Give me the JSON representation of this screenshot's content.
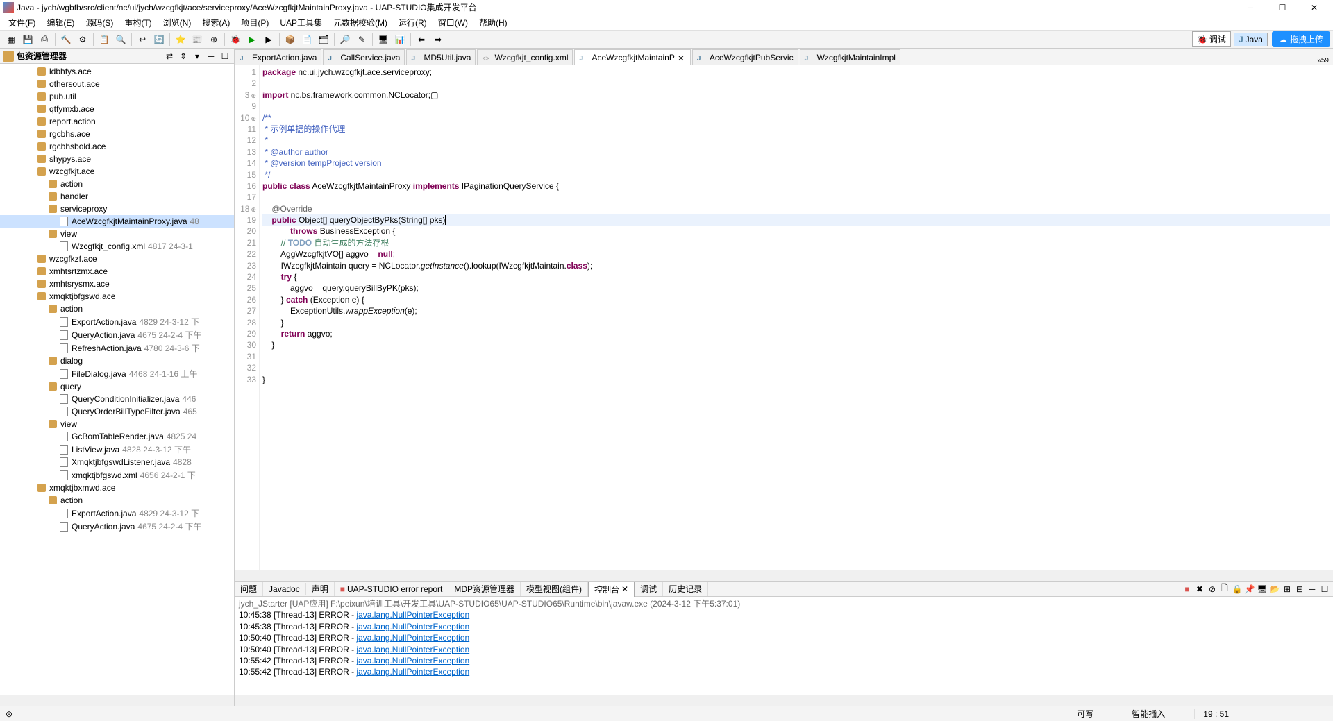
{
  "window": {
    "title": "Java - jych/wgbfb/src/client/nc/ui/jych/wzcgfkjt/ace/serviceproxy/AceWzcgfkjtMaintainProxy.java - UAP-STUDIO集成开发平台"
  },
  "menu": {
    "file": "文件(F)",
    "edit": "编辑(E)",
    "source": "源码(S)",
    "refactor": "重构(T)",
    "navigate": "浏览(N)",
    "search": "搜索(A)",
    "project": "项目(P)",
    "uap": "UAP工具集",
    "metadata": "元数据校验(M)",
    "run": "运行(R)",
    "window": "窗口(W)",
    "help": "帮助(H)"
  },
  "perspective": {
    "debug": "调试",
    "java": "Java",
    "upload": "拖拽上传"
  },
  "leftPanel": {
    "title": "包资源管理器",
    "items": [
      {
        "depth": 3,
        "icon": "pkg",
        "label": "ldbhfys.ace"
      },
      {
        "depth": 3,
        "icon": "pkg",
        "label": "othersout.ace"
      },
      {
        "depth": 3,
        "icon": "pkg",
        "label": "pub.util"
      },
      {
        "depth": 3,
        "icon": "pkg",
        "label": "qtfymxb.ace"
      },
      {
        "depth": 3,
        "icon": "pkg",
        "label": "report.action"
      },
      {
        "depth": 3,
        "icon": "pkg",
        "label": "rgcbhs.ace"
      },
      {
        "depth": 3,
        "icon": "pkg",
        "label": "rgcbhsbold.ace"
      },
      {
        "depth": 3,
        "icon": "pkg",
        "label": "shypys.ace"
      },
      {
        "depth": 3,
        "icon": "pkg",
        "label": "wzcgfkjt.ace"
      },
      {
        "depth": 4,
        "icon": "pkg",
        "label": "action"
      },
      {
        "depth": 4,
        "icon": "pkg",
        "label": "handler"
      },
      {
        "depth": 4,
        "icon": "pkg",
        "label": "serviceproxy"
      },
      {
        "depth": 5,
        "icon": "file",
        "label": "AceWzcgfkjtMaintainProxy.java",
        "meta": "48",
        "selected": true
      },
      {
        "depth": 4,
        "icon": "pkg",
        "label": "view"
      },
      {
        "depth": 5,
        "icon": "file",
        "label": "Wzcgfkjt_config.xml",
        "meta": "4817  24-3-1"
      },
      {
        "depth": 3,
        "icon": "pkg",
        "label": "wzcgfkzf.ace"
      },
      {
        "depth": 3,
        "icon": "pkg",
        "label": "xmhtsrtzmx.ace"
      },
      {
        "depth": 3,
        "icon": "pkg",
        "label": "xmhtsrysmx.ace"
      },
      {
        "depth": 3,
        "icon": "pkg",
        "label": "xmqktjbfgswd.ace"
      },
      {
        "depth": 4,
        "icon": "pkg",
        "label": "action"
      },
      {
        "depth": 5,
        "icon": "file",
        "label": "ExportAction.java",
        "meta": "4829  24-3-12 下"
      },
      {
        "depth": 5,
        "icon": "file",
        "label": "QueryAction.java",
        "meta": "4675  24-2-4 下午"
      },
      {
        "depth": 5,
        "icon": "file",
        "label": "RefreshAction.java",
        "meta": "4780  24-3-6 下"
      },
      {
        "depth": 4,
        "icon": "pkg",
        "label": "dialog"
      },
      {
        "depth": 5,
        "icon": "file",
        "label": "FileDialog.java",
        "meta": "4468  24-1-16 上午"
      },
      {
        "depth": 4,
        "icon": "pkg",
        "label": "query"
      },
      {
        "depth": 5,
        "icon": "file",
        "label": "QueryConditionInitializer.java",
        "meta": "446"
      },
      {
        "depth": 5,
        "icon": "file",
        "label": "QueryOrderBillTypeFilter.java",
        "meta": "465"
      },
      {
        "depth": 4,
        "icon": "pkg",
        "label": "view"
      },
      {
        "depth": 5,
        "icon": "file",
        "label": "GcBomTableRender.java",
        "meta": "4825  24"
      },
      {
        "depth": 5,
        "icon": "file",
        "label": "ListView.java",
        "meta": "4828  24-3-12 下午"
      },
      {
        "depth": 5,
        "icon": "file",
        "label": "XmqktjbfgswdListener.java",
        "meta": "4828"
      },
      {
        "depth": 5,
        "icon": "file",
        "label": "xmqktjbfgswd.xml",
        "meta": "4656  24-2-1 下"
      },
      {
        "depth": 3,
        "icon": "pkg",
        "label": "xmqktjbxmwd.ace"
      },
      {
        "depth": 4,
        "icon": "pkg",
        "label": "action"
      },
      {
        "depth": 5,
        "icon": "file",
        "label": "ExportAction.java",
        "meta": "4829  24-3-12 下"
      },
      {
        "depth": 5,
        "icon": "file",
        "label": "QueryAction.java",
        "meta": "4675  24-2-4 下午"
      }
    ]
  },
  "tabs": [
    {
      "icon": "java",
      "label": "ExportAction.java"
    },
    {
      "icon": "java",
      "label": "CallService.java"
    },
    {
      "icon": "java",
      "label": "MD5Util.java"
    },
    {
      "icon": "xml",
      "label": "Wzcgfkjt_config.xml"
    },
    {
      "icon": "java",
      "label": "AceWzcgfkjtMaintainP",
      "active": true,
      "close": true
    },
    {
      "icon": "java",
      "label": "AceWzcgfkjtPubServic"
    },
    {
      "icon": "java",
      "label": "WzcgfkjtMaintainImpl"
    }
  ],
  "tabMore": "»59",
  "code": {
    "lines": [
      {
        "n": 1,
        "html": "<span class='kw'>package</span> nc.ui.jych.wzcgfkjt.ace.serviceproxy;"
      },
      {
        "n": 2,
        "html": ""
      },
      {
        "n": 3,
        "fold": true,
        "html": "<span class='kw'>import</span> nc.bs.framework.common.NCLocator;▢"
      },
      {
        "n": 9,
        "html": ""
      },
      {
        "n": 10,
        "fold": true,
        "html": "<span class='doc'>/**</span>"
      },
      {
        "n": 11,
        "html": "<span class='doc'> * 示例单据的操作代理</span>"
      },
      {
        "n": 12,
        "html": "<span class='doc'> * </span>"
      },
      {
        "n": 13,
        "html": "<span class='doc'> * @author author</span>"
      },
      {
        "n": 14,
        "html": "<span class='doc'> * @version tempProject version</span>"
      },
      {
        "n": 15,
        "html": "<span class='doc'> */</span>"
      },
      {
        "n": 16,
        "html": "<span class='kw'>public</span> <span class='kw'>class</span> AceWzcgfkjtMaintainProxy <span class='kw'>implements</span> IPaginationQueryService {"
      },
      {
        "n": 17,
        "html": ""
      },
      {
        "n": 18,
        "fold": true,
        "html": "    <span class='ann'>@Override</span>"
      },
      {
        "n": 19,
        "hl": true,
        "html": "    <span class='kw'>public</span> Object[] queryObjectByPks(String[] pks)<span class='cursor'></span>"
      },
      {
        "n": 20,
        "html": "            <span class='kw'>throws</span> BusinessException {"
      },
      {
        "n": 21,
        "html": "        <span class='cm'>// </span><span class='todo'>TODO</span><span class='cm'> 自动生成的方法存根</span>"
      },
      {
        "n": 22,
        "html": "        AggWzcgfkjtVO[] aggvo = <span class='kw'>null</span>;"
      },
      {
        "n": 23,
        "html": "        IWzcgfkjtMaintain query = NCLocator.<span class='it'>getInstance</span>().lookup(IWzcgfkjtMaintain.<span class='kw'>class</span>);"
      },
      {
        "n": 24,
        "html": "        <span class='kw'>try</span> {"
      },
      {
        "n": 25,
        "html": "            aggvo = query.queryBillByPK(pks);"
      },
      {
        "n": 26,
        "html": "        } <span class='kw'>catch</span> (Exception e) {"
      },
      {
        "n": 27,
        "html": "            ExceptionUtils.<span class='it'>wrappException</span>(e);"
      },
      {
        "n": 28,
        "html": "        }"
      },
      {
        "n": 29,
        "html": "        <span class='kw'>return</span> aggvo;"
      },
      {
        "n": 30,
        "html": "    }"
      },
      {
        "n": 31,
        "html": ""
      },
      {
        "n": 32,
        "html": ""
      },
      {
        "n": 33,
        "html": "}"
      }
    ]
  },
  "bottomTabs": [
    {
      "label": "问题"
    },
    {
      "label": "Javadoc"
    },
    {
      "label": "声明"
    },
    {
      "label": "UAP-STUDIO error report",
      "icon": "■",
      "iconColor": "#d9534f"
    },
    {
      "label": "MDP资源管理器"
    },
    {
      "label": "模型视图(组件)"
    },
    {
      "label": "控制台",
      "active": true,
      "close": true
    },
    {
      "label": "调试"
    },
    {
      "label": "历史记录"
    }
  ],
  "console": {
    "header": "jych_JStarter [UAP应用] F:\\peixun\\培训工具\\开发工具\\UAP-STUDIO65\\UAP-STUDIO65\\Runtime\\bin\\javaw.exe (2024-3-12 下午5:37:01)",
    "lines": [
      {
        "time": "10:45:38",
        "thread": "[Thread-13]",
        "level": "ERROR",
        "link": "java.lang.NullPointerException"
      },
      {
        "time": "10:45:38",
        "thread": "[Thread-13]",
        "level": "ERROR",
        "link": "java.lang.NullPointerException"
      },
      {
        "time": "10:50:40",
        "thread": "[Thread-13]",
        "level": "ERROR",
        "link": "java.lang.NullPointerException"
      },
      {
        "time": "10:50:40",
        "thread": "[Thread-13]",
        "level": "ERROR",
        "link": "java.lang.NullPointerException"
      },
      {
        "time": "10:55:42",
        "thread": "[Thread-13]",
        "level": "ERROR",
        "link": "java.lang.NullPointerException"
      },
      {
        "time": "10:55:42",
        "thread": "[Thread-13]",
        "level": "ERROR",
        "link": "java.lang.NullPointerException"
      }
    ]
  },
  "status": {
    "writable": "可写",
    "insert": "智能插入",
    "pos": "19 : 51"
  }
}
